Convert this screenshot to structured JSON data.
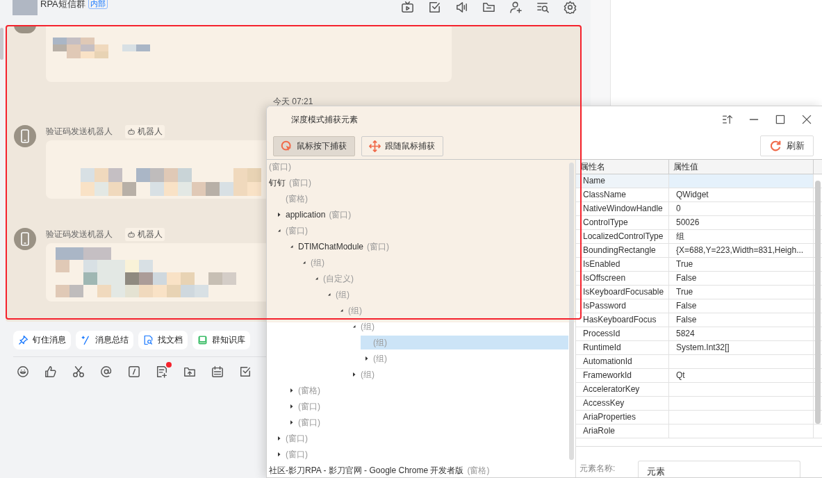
{
  "chat": {
    "group_name": "RPA短信群",
    "group_badge": "内部",
    "timestamp": "今天 07:21",
    "messages": [
      {
        "sender": "验证码发送机器人",
        "badge": "机器人"
      },
      {
        "sender": "验证码发送机器人",
        "badge": "机器人"
      }
    ],
    "quick_actions": [
      {
        "label": "钉住消息",
        "kind": "pin"
      },
      {
        "label": "消息总结",
        "kind": "sparkle"
      },
      {
        "label": "找文档",
        "kind": "doc-search"
      },
      {
        "label": "群知识库",
        "kind": "book"
      }
    ]
  },
  "inspector": {
    "title": "深度模式捕获元素",
    "capture_modes": [
      {
        "label": "鼠标按下捕获",
        "kind": "click",
        "selected": true
      },
      {
        "label": "跟随鼠标捕获",
        "kind": "follow",
        "selected": false
      }
    ],
    "refresh": "刷新",
    "tree": [
      {
        "kind": "root",
        "type": "(窗口)",
        "selected": false
      },
      {
        "kind": "root",
        "name": "钉钉",
        "type": "(窗口)",
        "selected": false,
        "children": [
          {
            "type": "(窗格)",
            "selected": false
          },
          {
            "name": "application",
            "type": "(窗口)",
            "expanded": false,
            "selected": false
          },
          {
            "type": "(窗口)",
            "expanded": true,
            "selected": false,
            "children": [
              {
                "name": "DTIMChatModule",
                "type": "(窗口)",
                "expanded": true,
                "selected": false,
                "children": [
                  {
                    "type": "(组)",
                    "expanded": true,
                    "selected": false,
                    "children": [
                      {
                        "type": "(自定义)",
                        "expanded": true,
                        "selected": false,
                        "children": [
                          {
                            "type": "(组)",
                            "expanded": true,
                            "selected": false,
                            "children": [
                              {
                                "type": "(组)",
                                "expanded": true,
                                "selected": false,
                                "children": [
                                  {
                                    "type": "(组)",
                                    "expanded": true,
                                    "selected": false,
                                    "children": [
                                      {
                                        "type": "(组)",
                                        "selected": true
                                      },
                                      {
                                        "type": "(组)",
                                        "expanded": false,
                                        "selected": false
                                      }
                                    ]
                                  },
                                  {
                                    "type": "(组)",
                                    "expanded": false,
                                    "selected": false
                                  }
                                ]
                              }
                            ]
                          }
                        ]
                      }
                    ]
                  }
                ]
              },
              {
                "type": "(窗格)",
                "expanded": false,
                "selected": false
              },
              {
                "type": "(窗口)",
                "expanded": false,
                "selected": false
              },
              {
                "type": "(窗口)",
                "expanded": false,
                "selected": false
              }
            ]
          },
          {
            "type": "(窗口)",
            "expanded": false,
            "selected": false
          },
          {
            "type": "(窗口)",
            "expanded": false,
            "selected": false
          }
        ]
      },
      {
        "kind": "root",
        "name": "社区-影刀RPA - 影刀官网 - Google Chrome 开发者版",
        "type": "(窗格)",
        "selected": false
      }
    ],
    "columns": [
      "属性名",
      "属性值"
    ],
    "properties": [
      {
        "name": "Name",
        "selected": true
      },
      {
        "name": "ClassName",
        "value": "QWidget",
        "selected": false
      },
      {
        "name": "NativeWindowHandle",
        "value": "0",
        "selected": false
      },
      {
        "name": "ControlType",
        "value": "50026",
        "selected": false
      },
      {
        "name": "LocalizedControlType",
        "value": "组",
        "selected": false
      },
      {
        "name": "BoundingRectangle",
        "value": "{X=688,Y=223,Width=831,Heigh...",
        "selected": false
      },
      {
        "name": "IsEnabled",
        "value": "True",
        "selected": false
      },
      {
        "name": "IsOffscreen",
        "value": "False",
        "selected": false
      },
      {
        "name": "IsKeyboardFocusable",
        "value": "True",
        "selected": false
      },
      {
        "name": "IsPassword",
        "value": "False",
        "selected": false
      },
      {
        "name": "HasKeyboardFocus",
        "value": "False",
        "selected": false
      },
      {
        "name": "ProcessId",
        "value": "5824",
        "selected": false
      },
      {
        "name": "RuntimeId",
        "value": "System.Int32[]",
        "selected": false
      },
      {
        "name": "AutomationId",
        "selected": false
      },
      {
        "name": "FrameworkId",
        "value": "Qt",
        "selected": false
      },
      {
        "name": "AcceleratorKey",
        "selected": false
      },
      {
        "name": "AccessKey",
        "selected": false
      },
      {
        "name": "AriaProperties",
        "selected": false
      },
      {
        "name": "AriaRole",
        "selected": false
      }
    ],
    "element_name_label": "元素名称:",
    "element_name_value": "元素"
  }
}
